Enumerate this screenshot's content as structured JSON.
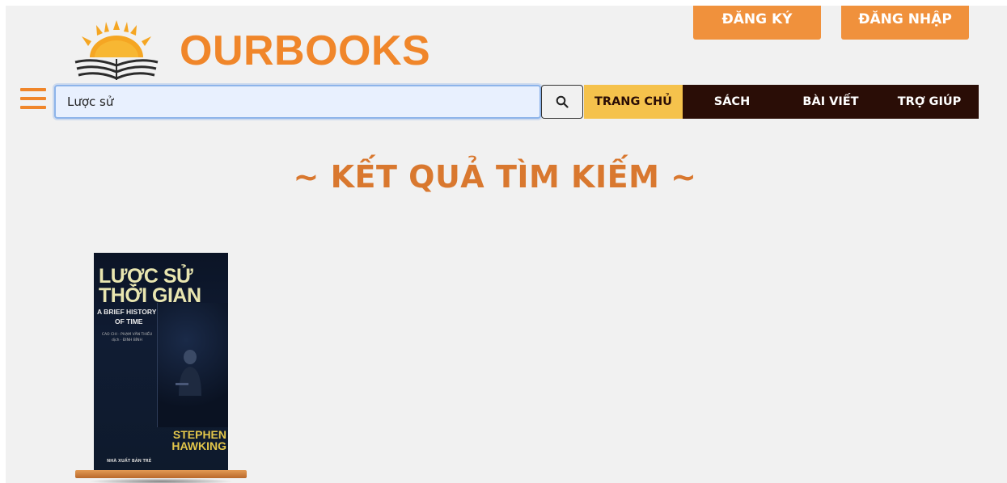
{
  "header": {
    "register_label": "ĐĂNG KÝ",
    "login_label": "ĐĂNG NHẬP",
    "logo_text": "OURBOOKS"
  },
  "search": {
    "value": "Lược sử"
  },
  "nav": {
    "items": [
      {
        "label": "TRANG CHỦ",
        "active": true
      },
      {
        "label": "SÁCH"
      },
      {
        "label": "BÀI VIẾT"
      },
      {
        "label": "TRỢ GIÚP"
      }
    ]
  },
  "results": {
    "title": "~ KẾT QUẢ TÌM KIẾM ~",
    "books": [
      {
        "cover_title_line1": "LƯỢC SỬ",
        "cover_title_line2": "THỜI GIAN",
        "cover_subtitle_line1": "A BRIEF HISTORY",
        "cover_subtitle_line2": "OF TIME",
        "cover_translator": "CAO CHI · PHẠM VĂN THIỀU dịch · ĐINH BÌNH",
        "cover_author_line1": "STEPHEN",
        "cover_author_line2": "HAWKING",
        "cover_publisher": "NHÀ XUẤT BẢN TRẺ"
      }
    ]
  },
  "colors": {
    "accent": "#f0862a",
    "nav_bg": "#2a0d06",
    "nav_active": "#f5c24c",
    "title": "#d9782f"
  }
}
